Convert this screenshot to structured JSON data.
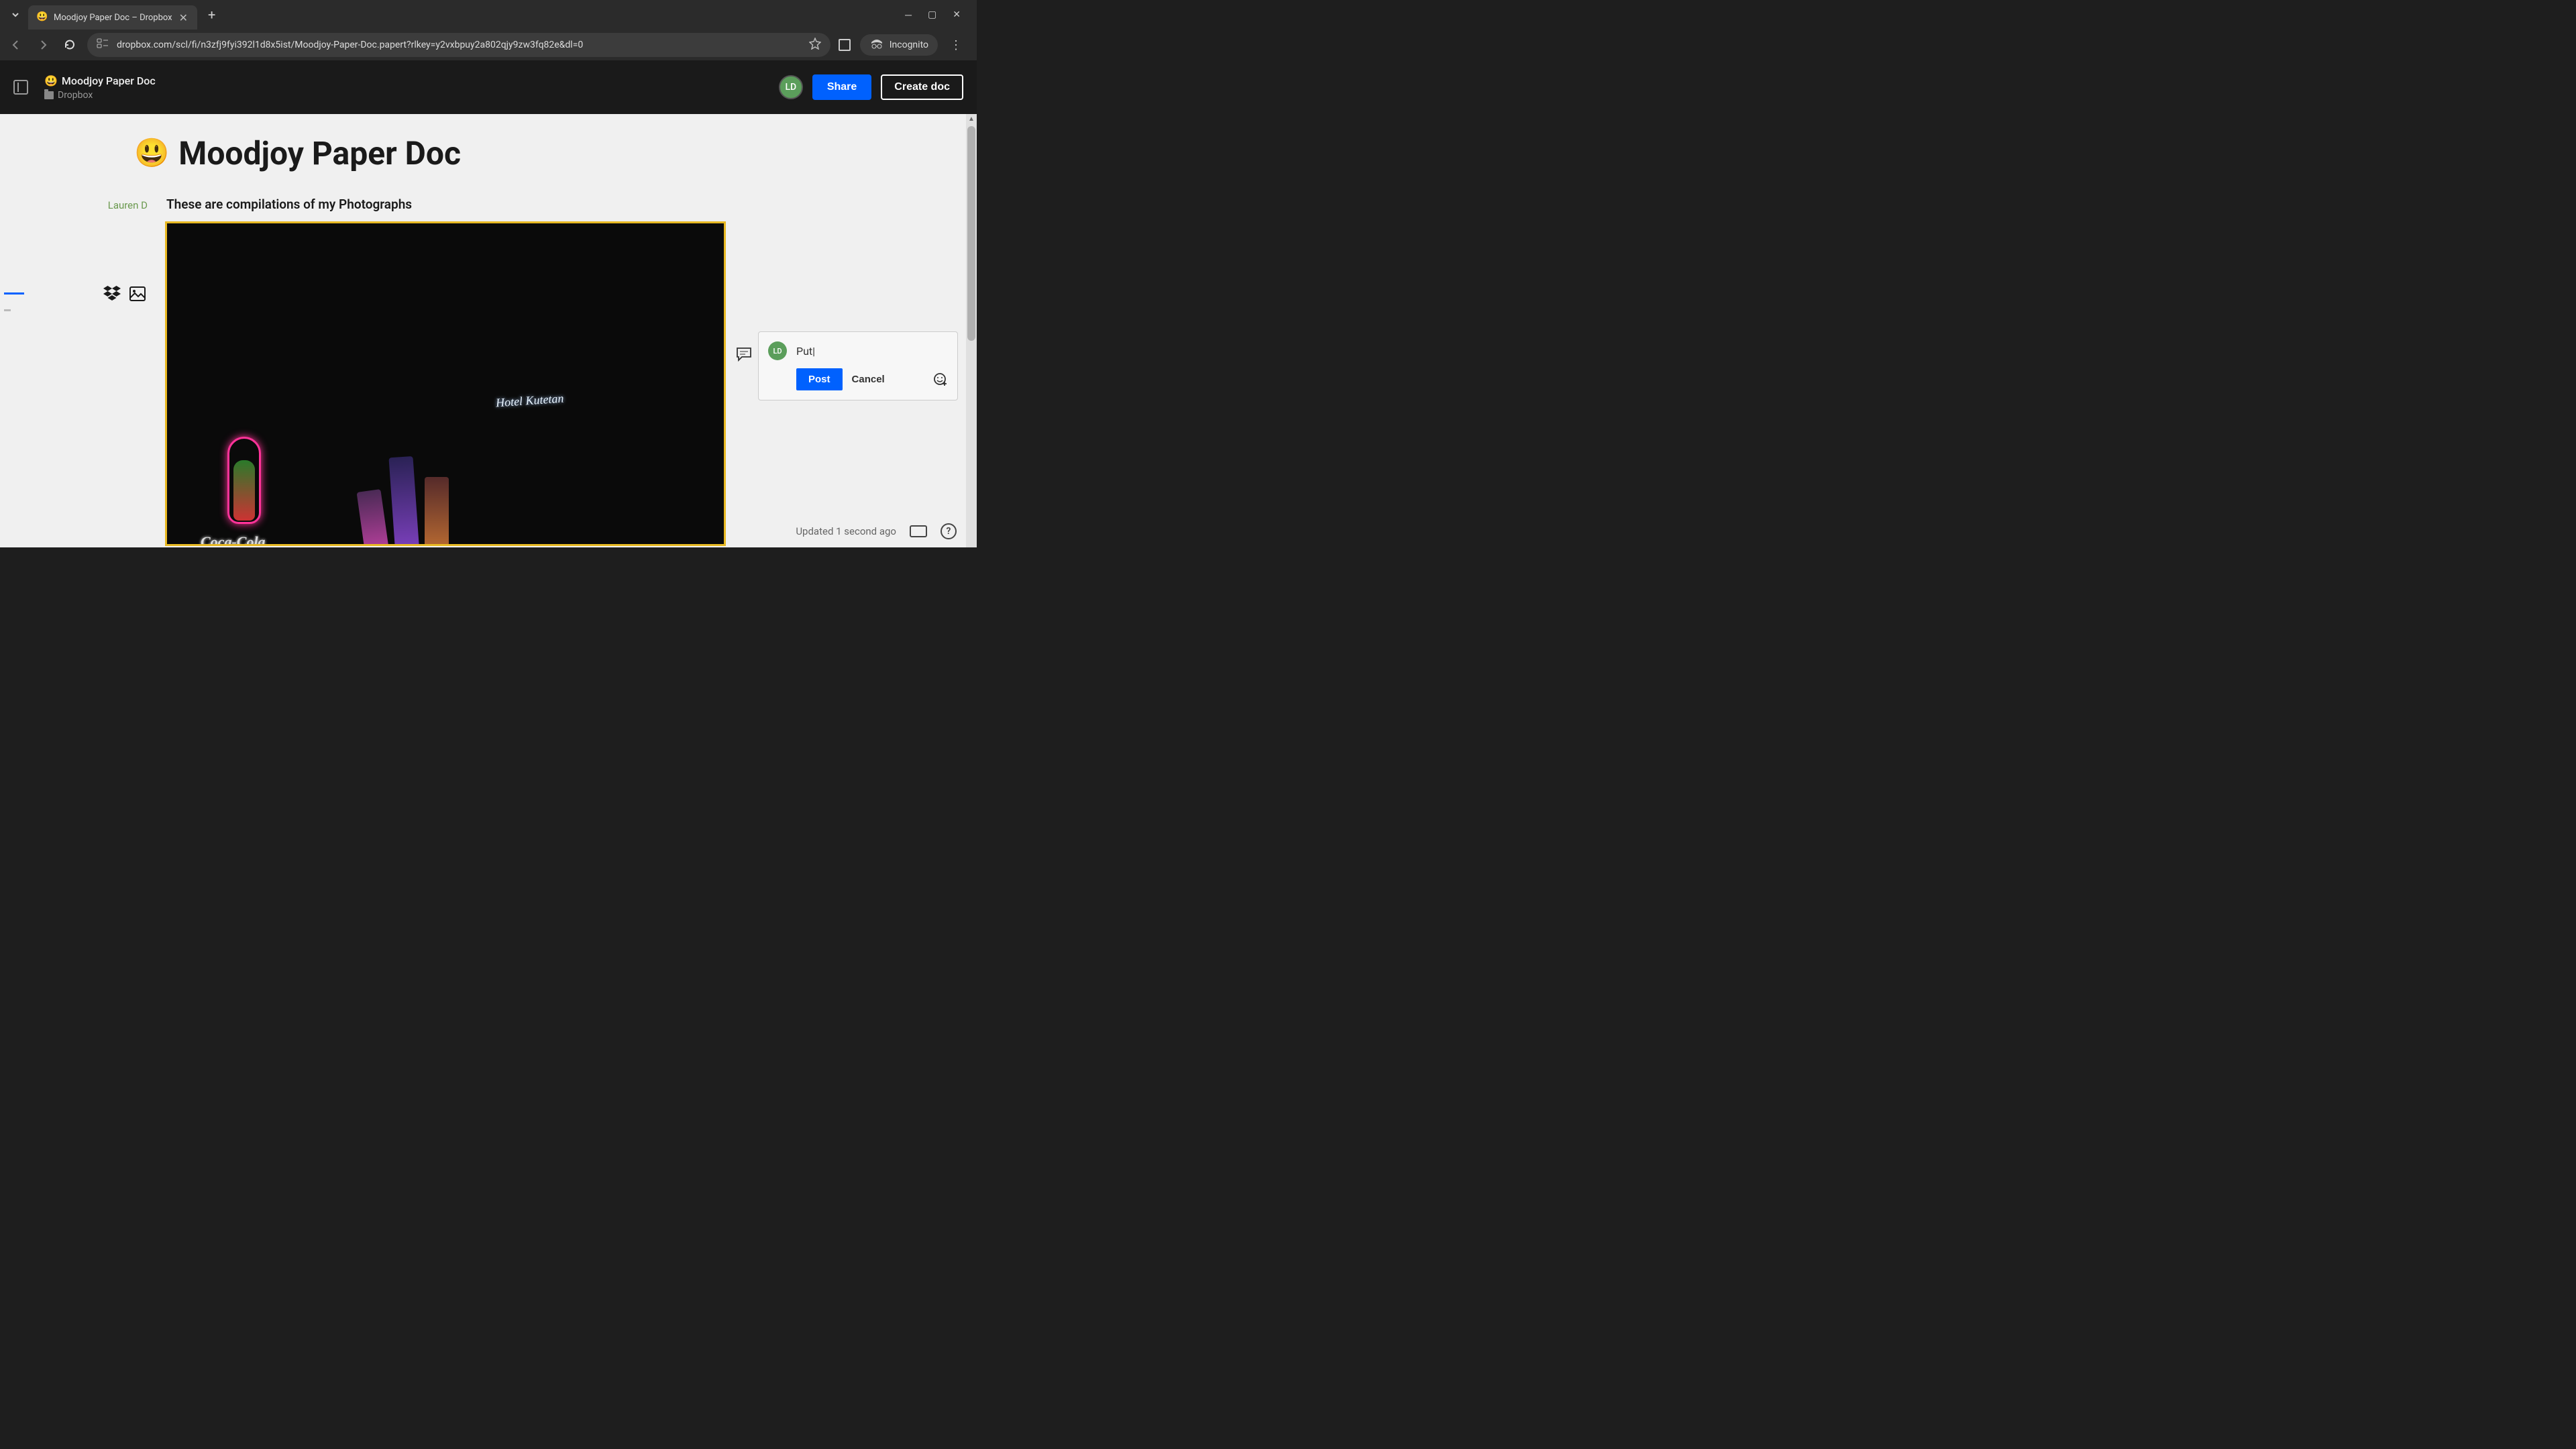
{
  "browser": {
    "tab_title": "Moodjoy Paper Doc – Dropbox",
    "url": "dropbox.com/scl/fi/n3zfj9fyi392l1d8x5ist/Moodjoy-Paper-Doc.papert?rlkey=y2vxbpuy2a802qjy9zw3fq82e&dl=0",
    "incognito_label": "Incognito"
  },
  "header": {
    "doc_emoji": "😃",
    "doc_name": "Moodjoy Paper Doc",
    "breadcrumb": "Dropbox",
    "avatar_initials": "LD",
    "share_label": "Share",
    "create_label": "Create doc"
  },
  "document": {
    "title_emoji": "😃",
    "title": "Moodjoy Paper Doc",
    "author": "Lauren D",
    "subtitle": "These are compilations of my Photographs",
    "image_text_coke": "Coca-Cola",
    "image_text_hotel": "Hotel Kutetan"
  },
  "comment": {
    "avatar_initials": "LD",
    "draft_text": "Put",
    "post_label": "Post",
    "cancel_label": "Cancel"
  },
  "status": {
    "updated_text": "Updated 1 second ago",
    "help_label": "?"
  }
}
